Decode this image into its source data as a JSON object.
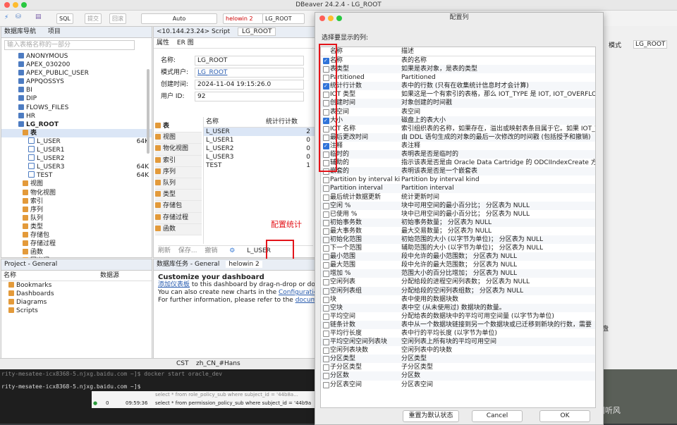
{
  "window": {
    "title": "DBeaver 24.2.4 - LG_ROOT"
  },
  "toolbar": {
    "sql": "SQL",
    "commit": "提交",
    "rollback": "回滚",
    "auto": "Auto",
    "connection": "helowin 2",
    "schema": "LG_ROOT",
    "mode": "模式",
    "schema_right": "LG_ROOT"
  },
  "navigator": {
    "tab1": "数据库导航",
    "tab2": "项目",
    "filter_placeholder": "输入表格名称的一部分",
    "items": [
      {
        "label": "ANONYMOUS",
        "icon": "db",
        "size": ""
      },
      {
        "label": "APEX_030200",
        "icon": "db",
        "size": ""
      },
      {
        "label": "APEX_PUBLIC_USER",
        "icon": "db",
        "size": ""
      },
      {
        "label": "APPQOSSYS",
        "icon": "db",
        "size": ""
      },
      {
        "label": "BI",
        "icon": "db",
        "size": ""
      },
      {
        "label": "DIP",
        "icon": "db",
        "size": ""
      },
      {
        "label": "FLOWS_FILES",
        "icon": "db",
        "size": ""
      },
      {
        "label": "HR",
        "icon": "db",
        "size": ""
      },
      {
        "label": "LG_ROOT",
        "icon": "db",
        "size": ""
      },
      {
        "label": "表",
        "icon": "folder",
        "size": ""
      },
      {
        "label": "L_USER",
        "icon": "table",
        "size": "64K"
      },
      {
        "label": "L_USER1",
        "icon": "table",
        "size": ""
      },
      {
        "label": "L_USER2",
        "icon": "table",
        "size": ""
      },
      {
        "label": "L_USER3",
        "icon": "table",
        "size": "64K"
      },
      {
        "label": "TEST",
        "icon": "table",
        "size": "64K"
      },
      {
        "label": "视图",
        "icon": "folder",
        "size": ""
      },
      {
        "label": "物化视图",
        "icon": "folder",
        "size": ""
      },
      {
        "label": "索引",
        "icon": "folder",
        "size": ""
      },
      {
        "label": "序列",
        "icon": "folder",
        "size": ""
      },
      {
        "label": "队列",
        "icon": "folder",
        "size": ""
      },
      {
        "label": "类型",
        "icon": "folder",
        "size": ""
      },
      {
        "label": "存储包",
        "icon": "folder",
        "size": ""
      },
      {
        "label": "存储过程",
        "icon": "folder",
        "size": ""
      },
      {
        "label": "函数",
        "icon": "folder",
        "size": ""
      },
      {
        "label": "同义词",
        "icon": "folder",
        "size": ""
      }
    ]
  },
  "editor": {
    "tab_script": "<10.144.23.24> Script",
    "tab_schema": "LG_ROOT",
    "subtab_props": "属性",
    "subtab_er": "ER 图",
    "fields": [
      {
        "label": "名称:",
        "value": "LG_ROOT"
      },
      {
        "label": "模式用户:",
        "value": "LG_ROOT"
      },
      {
        "label": "创建时间:",
        "value": "2024-11-04 19:15:26.0"
      },
      {
        "label": "用户 ID:",
        "value": "92"
      }
    ],
    "categories": [
      "表",
      "视图",
      "物化视图",
      "索引",
      "序列",
      "队列",
      "类型",
      "存储包",
      "存储过程",
      "函数"
    ],
    "grid_headers": [
      "名称",
      "统计行计数"
    ],
    "grid_rows": [
      {
        "name": "L_USER",
        "count": "2"
      },
      {
        "name": "L_USER1",
        "count": "0"
      },
      {
        "name": "L_USER2",
        "count": "0"
      },
      {
        "name": "L_USER3",
        "count": "0"
      },
      {
        "name": "TEST",
        "count": "1"
      }
    ],
    "bottom_actions": [
      "刷新",
      "保存...",
      "撤销"
    ],
    "footer_item": "L_USER",
    "annotation": "配置统计"
  },
  "project": {
    "tab": "Project - General",
    "headers": [
      "名称",
      "数据源"
    ],
    "items": [
      "Bookmarks",
      "Dashboards",
      "Diagrams",
      "Scripts"
    ]
  },
  "dashboard": {
    "tab1": "数据库任务 - General",
    "tab2": "helowin 2",
    "heading": "Customize your dashboard",
    "line1_link": "添加仪表板",
    "line1": " to this dashboard by drag-n-drop or double-cli",
    "line2": "You can also create new charts in the ",
    "line2_link": "Configuration",
    "line2_tail": " dialog",
    "line3": "For further information, please refer to the ",
    "line3_link": "documentation"
  },
  "status": {
    "cst": "CST",
    "locale": "zh_CN_#Hans"
  },
  "terminal": {
    "line1": "rity-mesatee-icx8368-5.njxg.baidu.com ~]$ docker start oracle_dev",
    "line2": "rity-mesatee-icx8368-5.njxg.baidu.com ~]$",
    "log_row1": "select * from role_policy_sub where subject_id = '44b8a...",
    "log_count": "0",
    "log_time": "09:59:36",
    "log_row2": "select * from permission_policy_sub where subject_id = '44b9a",
    "watermark": "CSDN @倚剑听风"
  },
  "right_strip": {
    "label": "盘"
  },
  "dialog": {
    "title": "配置列",
    "prompt": "选择要显示的列:",
    "col_header_name": "名称",
    "col_header_desc": "描述",
    "buttons": {
      "reset": "重置为默认状态",
      "cancel": "Cancel",
      "ok": "OK"
    },
    "rows": [
      {
        "name": "名称",
        "desc": "表的名称",
        "checked": true
      },
      {
        "name": "表类型",
        "desc": "如果是表对象，是表的类型",
        "checked": false
      },
      {
        "name": "Partitioned",
        "desc": "Partitioned",
        "checked": false
      },
      {
        "name": "统计行计数",
        "desc": "表中的行数 (只有在收集统计信息时才会计算)",
        "checked": true
      },
      {
        "name": "IOT 类型",
        "desc": "如果这是一个有索引的表格，那么 IOT_TYPE 是 IOT, IOT_OVERFLOW",
        "checked": false
      },
      {
        "name": "创建时间",
        "desc": "对象创建的时间戳",
        "checked": false
      },
      {
        "name": "表空间",
        "desc": "表空间",
        "checked": false
      },
      {
        "name": "大小",
        "desc": "磁盘上的表大小",
        "checked": true
      },
      {
        "name": "IOT 名称",
        "desc": "索引组织表的名称，如果存在，溢出或映射表条目属于它。如果 IOT_TY",
        "checked": false
      },
      {
        "name": "最后更改时间",
        "desc": "由 DDL 语句生成的对象的最后一次修改的时间戳 (包括授予和撤销)",
        "checked": false
      },
      {
        "name": "注释",
        "desc": "表注释",
        "checked": true
      },
      {
        "name": "临时的",
        "desc": "表明表是否是临时的",
        "checked": false
      },
      {
        "name": "辅助的",
        "desc": "指示该表是否是由 Oracle Data Cartridge 的 ODCIIndexCreate 方法",
        "checked": false
      },
      {
        "name": "嵌套的",
        "desc": "表明该表是否是一个嵌套表",
        "checked": false
      },
      {
        "name": "Partition by interval kind",
        "desc": "Partition by interval kind",
        "checked": false
      },
      {
        "name": "Partition interval",
        "desc": "Partition interval",
        "checked": false
      },
      {
        "name": "最后统计数据更新",
        "desc": "统计更新时间",
        "checked": false
      },
      {
        "name": "空闲 %",
        "desc": "块中可用空间的最小百分比； 分区表为 NULL",
        "checked": false
      },
      {
        "name": "已使用 %",
        "desc": "块中已用空间的最小百分比； 分区表为 NULL",
        "checked": false
      },
      {
        "name": "初始事务数",
        "desc": "初始事务数量； 分区表为 NULL",
        "checked": false
      },
      {
        "name": "最大事务数",
        "desc": "最大交易数量； 分区表为 NULL",
        "checked": false
      },
      {
        "name": "初始化范围",
        "desc": "初始范围的大小 (以字节为单位)； 分区表为 NULL",
        "checked": false
      },
      {
        "name": "下一个范围",
        "desc": "辅助范围的大小 (以字节为单位)； 分区表为 NULL",
        "checked": false
      },
      {
        "name": "最小范围",
        "desc": "段中允许的最小范围数； 分区表为 NULL",
        "checked": false
      },
      {
        "name": "最大范围",
        "desc": "段中允许的最大范围数； 分区表为 NULL",
        "checked": false
      },
      {
        "name": "增加 %",
        "desc": "范围大小的百分比增加； 分区表为 NULL",
        "checked": false
      },
      {
        "name": "空闲列表",
        "desc": "分配给段的进程空闲列表数； 分区表为 NULL",
        "checked": false
      },
      {
        "name": "空闲列表组",
        "desc": "分配给段的空闲列表组数； 分区表为 NULL",
        "checked": false
      },
      {
        "name": "块",
        "desc": "表中使用的数据块数",
        "checked": false
      },
      {
        "name": "空块",
        "desc": "表中空 (从未使用过) 数据块的数量。",
        "checked": false
      },
      {
        "name": "平均空间",
        "desc": "分配给表的数据块中的平均可用空间量 (以字节为单位)",
        "checked": false
      },
      {
        "name": "链条计数",
        "desc": "表中从一个数据块链接到另一个数据块或已迁移到新块的行数，需要",
        "checked": false
      },
      {
        "name": "平均行长度",
        "desc": "表中行的平均长度 (以字节为单位)",
        "checked": false
      },
      {
        "name": "平均空闲空间列表块",
        "desc": "空闲列表上所有块的平均可用空间",
        "checked": false
      },
      {
        "name": "空闲列表块数",
        "desc": "空闲列表中的块数",
        "checked": false
      },
      {
        "name": "分区类型",
        "desc": "分区类型",
        "checked": false
      },
      {
        "name": "子分区类型",
        "desc": "子分区类型",
        "checked": false
      },
      {
        "name": "分区数",
        "desc": "分区数",
        "checked": false
      },
      {
        "name": "分区表空间",
        "desc": "分区表空间",
        "checked": false
      }
    ]
  },
  "colors": {
    "accent": "#2f73d9",
    "highlight": "#e3141a"
  }
}
